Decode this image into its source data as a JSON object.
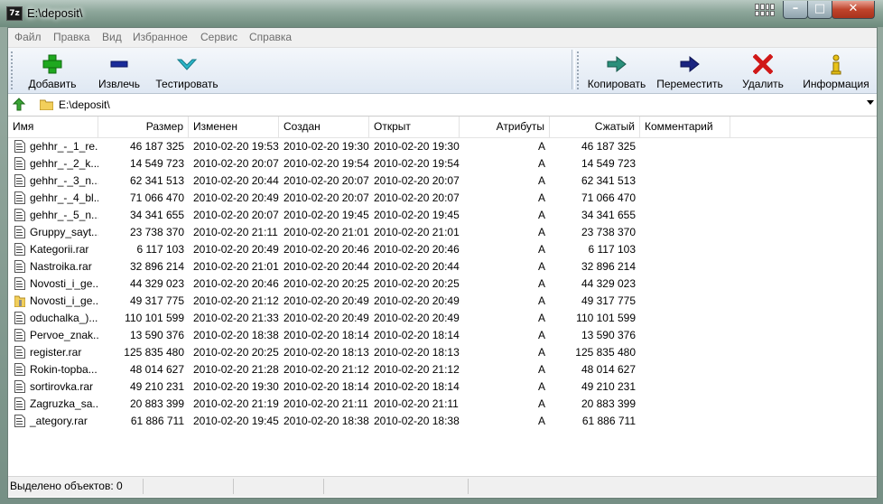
{
  "window": {
    "app_icon": "7z",
    "title": "E:\\deposit\\"
  },
  "menu": [
    "Файл",
    "Правка",
    "Вид",
    "Избранное",
    "Сервис",
    "Справка"
  ],
  "toolbar": {
    "add": "Добавить",
    "extract": "Извлечь",
    "test": "Тестировать",
    "copy": "Копировать",
    "move": "Переместить",
    "delete": "Удалить",
    "info": "Информация"
  },
  "address": {
    "path": "E:\\deposit\\"
  },
  "columns": {
    "name": "Имя",
    "size": "Размер",
    "modified": "Изменен",
    "created": "Создан",
    "accessed": "Открыт",
    "attributes": "Атрибуты",
    "packed": "Сжатый",
    "comment": "Комментарий"
  },
  "files": [
    {
      "name": "gehhr_-_1_re...",
      "size": "46 187 325",
      "modified": "2010-02-20 19:53",
      "created": "2010-02-20 19:30",
      "accessed": "2010-02-20 19:30",
      "attr": "A",
      "packed": "46 187 325",
      "icon": "file-icon"
    },
    {
      "name": "gehhr_-_2_k...",
      "size": "14 549 723",
      "modified": "2010-02-20 20:07",
      "created": "2010-02-20 19:54",
      "accessed": "2010-02-20 19:54",
      "attr": "A",
      "packed": "14 549 723",
      "icon": "file-icon"
    },
    {
      "name": "gehhr_-_3_n...",
      "size": "62 341 513",
      "modified": "2010-02-20 20:44",
      "created": "2010-02-20 20:07",
      "accessed": "2010-02-20 20:07",
      "attr": "A",
      "packed": "62 341 513",
      "icon": "file-icon"
    },
    {
      "name": "gehhr_-_4_bl...",
      "size": "71 066 470",
      "modified": "2010-02-20 20:49",
      "created": "2010-02-20 20:07",
      "accessed": "2010-02-20 20:07",
      "attr": "A",
      "packed": "71 066 470",
      "icon": "file-icon"
    },
    {
      "name": "gehhr_-_5_n...",
      "size": "34 341 655",
      "modified": "2010-02-20 20:07",
      "created": "2010-02-20 19:45",
      "accessed": "2010-02-20 19:45",
      "attr": "A",
      "packed": "34 341 655",
      "icon": "file-icon"
    },
    {
      "name": "Gruppy_sayt...",
      "size": "23 738 370",
      "modified": "2010-02-20 21:11",
      "created": "2010-02-20 21:01",
      "accessed": "2010-02-20 21:01",
      "attr": "A",
      "packed": "23 738 370",
      "icon": "file-icon"
    },
    {
      "name": "Kategorii.rar",
      "size": "6 117 103",
      "modified": "2010-02-20 20:49",
      "created": "2010-02-20 20:46",
      "accessed": "2010-02-20 20:46",
      "attr": "A",
      "packed": "6 117 103",
      "icon": "file-icon"
    },
    {
      "name": "Nastroika.rar",
      "size": "32 896 214",
      "modified": "2010-02-20 21:01",
      "created": "2010-02-20 20:44",
      "accessed": "2010-02-20 20:44",
      "attr": "A",
      "packed": "32 896 214",
      "icon": "file-icon"
    },
    {
      "name": "Novosti_i_ge...",
      "size": "44 329 023",
      "modified": "2010-02-20 20:46",
      "created": "2010-02-20 20:25",
      "accessed": "2010-02-20 20:25",
      "attr": "A",
      "packed": "44 329 023",
      "icon": "file-icon"
    },
    {
      "name": "Novosti_i_ge...",
      "size": "49 317 775",
      "modified": "2010-02-20 21:12",
      "created": "2010-02-20 20:49",
      "accessed": "2010-02-20 20:49",
      "attr": "A",
      "packed": "49 317 775",
      "icon": "archive-folder-icon"
    },
    {
      "name": "oduchalka_)....",
      "size": "110 101 599",
      "modified": "2010-02-20 21:33",
      "created": "2010-02-20 20:49",
      "accessed": "2010-02-20 20:49",
      "attr": "A",
      "packed": "110 101 599",
      "icon": "file-icon"
    },
    {
      "name": "Pervoe_znak...",
      "size": "13 590 376",
      "modified": "2010-02-20 18:38",
      "created": "2010-02-20 18:14",
      "accessed": "2010-02-20 18:14",
      "attr": "A",
      "packed": "13 590 376",
      "icon": "file-icon"
    },
    {
      "name": "register.rar",
      "size": "125 835 480",
      "modified": "2010-02-20 20:25",
      "created": "2010-02-20 18:13",
      "accessed": "2010-02-20 18:13",
      "attr": "A",
      "packed": "125 835 480",
      "icon": "file-icon"
    },
    {
      "name": "Rokin-topba...",
      "size": "48 014 627",
      "modified": "2010-02-20 21:28",
      "created": "2010-02-20 21:12",
      "accessed": "2010-02-20 21:12",
      "attr": "A",
      "packed": "48 014 627",
      "icon": "file-icon"
    },
    {
      "name": "sortirovka.rar",
      "size": "49 210 231",
      "modified": "2010-02-20 19:30",
      "created": "2010-02-20 18:14",
      "accessed": "2010-02-20 18:14",
      "attr": "A",
      "packed": "49 210 231",
      "icon": "file-icon"
    },
    {
      "name": "Zagruzka_sa...",
      "size": "20 883 399",
      "modified": "2010-02-20 21:19",
      "created": "2010-02-20 21:11",
      "accessed": "2010-02-20 21:11",
      "attr": "A",
      "packed": "20 883 399",
      "icon": "file-icon"
    },
    {
      "name": "_ategory.rar",
      "size": "61 886 711",
      "modified": "2010-02-20 19:45",
      "created": "2010-02-20 18:38",
      "accessed": "2010-02-20 18:38",
      "attr": "A",
      "packed": "61 886 711",
      "icon": "file-icon"
    }
  ],
  "status": {
    "selected": "Выделено объектов: 0"
  },
  "colors": {
    "add": "#1fa81f",
    "extract": "#1a2b9a",
    "test": "#2bb6c9",
    "copy": "#2a8f7a",
    "move": "#1a2480",
    "delete": "#d01818",
    "info": "#e8c218"
  }
}
